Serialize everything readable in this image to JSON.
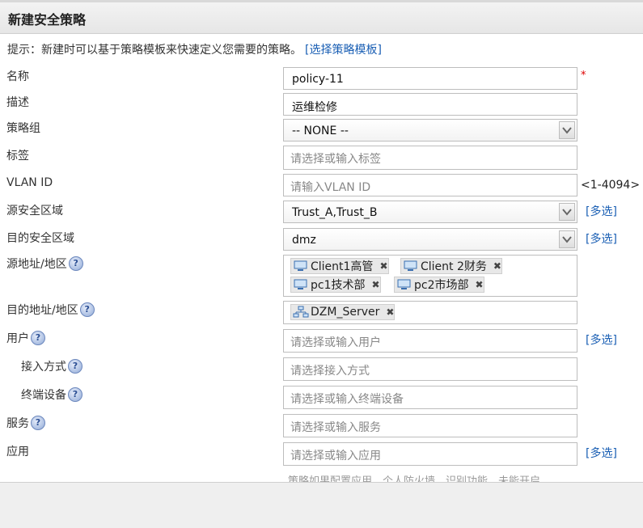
{
  "dialog": {
    "title": "新建安全策略"
  },
  "hint": {
    "text": "提示：新建时可以基于策略模板来快速定义您需要的策略。",
    "link": "[选择策略模板]"
  },
  "labels": {
    "name": "名称",
    "desc": "描述",
    "group": "策略组",
    "tag": "标签",
    "vlan": "VLAN ID",
    "src_zone": "源安全区域",
    "dst_zone": "目的安全区域",
    "src_addr": "源地址/地区",
    "dst_addr": "目的地址/地区",
    "user": "用户",
    "access": "接入方式",
    "terminal": "终端设备",
    "service": "服务",
    "app": "应用"
  },
  "fields": {
    "name": "policy-11",
    "desc": "运维检修",
    "group": "-- NONE --",
    "src_zone": "Trust_A,Trust_B",
    "dst_zone": "dmz"
  },
  "placeholders": {
    "tag": "请选择或输入标签",
    "vlan": "请输入VLAN ID",
    "user": "请选择或输入用户",
    "access": "请选择接入方式",
    "terminal": "请选择或输入终端设备",
    "service": "请选择或输入服务",
    "app": "请选择或输入应用"
  },
  "required_mark": "*",
  "vlan_range": "<1-4094>",
  "multi_select": "[多选]",
  "help_glyph": "?",
  "src_tags": [
    {
      "label": "Client1高管",
      "icon": "computer-icon"
    },
    {
      "label": "Client 2财务",
      "icon": "computer-icon"
    },
    {
      "label": "pc1技术部",
      "icon": "computer-icon"
    },
    {
      "label": "pc2市场部",
      "icon": "computer-icon"
    }
  ],
  "dst_tags": [
    {
      "label": "DZM_Server",
      "icon": "network-icon"
    }
  ],
  "remove_glyph": "✖",
  "truncated_note": "策略如果配置应用，个人防火墙，识别功能，未能开启",
  "colors": {
    "link": "#1a5fb4",
    "required": "#dd0000",
    "tag_bg": "#e8e8e8"
  }
}
